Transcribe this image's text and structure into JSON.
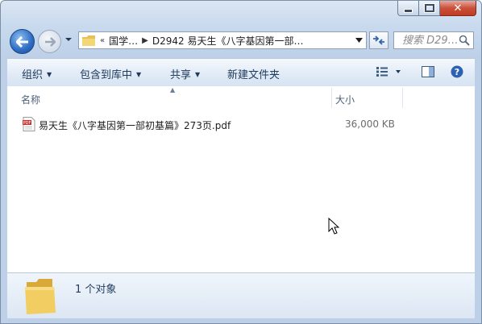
{
  "window": {
    "caption": {
      "minimize_icon": "minimize-icon",
      "maximize_icon": "maximize-icon",
      "close_icon": "close-icon"
    }
  },
  "nav": {
    "back_icon": "back-arrow-icon",
    "forward_icon": "forward-arrow-icon",
    "breadcrumb": {
      "overflow": "«",
      "items": [
        "国学…",
        "D2942 易天生《八字基因第一部…"
      ]
    },
    "refresh_icon": "refresh-icon",
    "search": {
      "placeholder": "搜索 D29…"
    }
  },
  "toolbar": {
    "organize": "组织",
    "include_in_library": "包含到库中",
    "share": "共享",
    "new_folder": "新建文件夹",
    "view_icon": "view-options-icon",
    "preview_pane_icon": "preview-pane-icon",
    "help_icon": "help-icon"
  },
  "columns": {
    "name": "名称",
    "size": "大小"
  },
  "files": [
    {
      "name": "易天生《八字基因第一部初基篇》273页.pdf",
      "size": "36,000 KB",
      "icon": "pdf-file-icon"
    }
  ],
  "details": {
    "count": "1 个对象",
    "icon": "folder-icon"
  },
  "colors": {
    "accent": "#1e395b",
    "close": "#c43a22"
  }
}
